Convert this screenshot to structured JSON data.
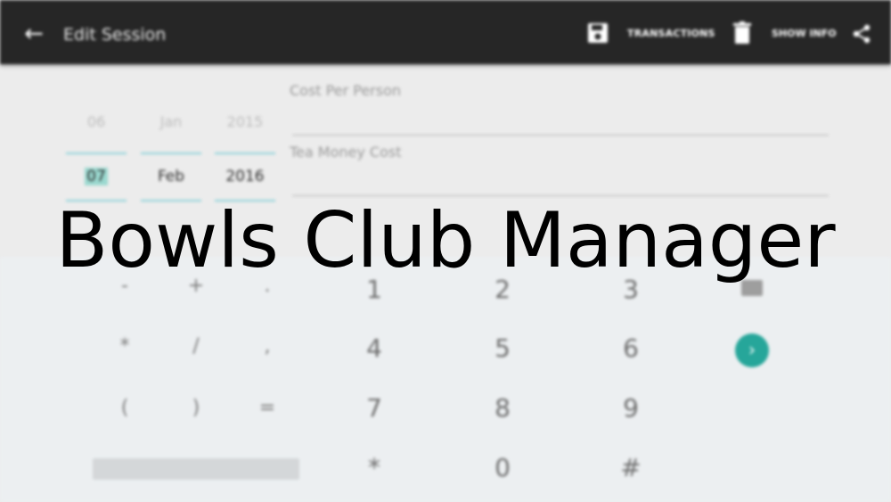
{
  "appbar": {
    "title": "Edit Session",
    "transactions_label": "TRANSACTIONS",
    "show_info_label": "SHOW INFO"
  },
  "date_picker": {
    "day": {
      "prev": "06",
      "selected": "07"
    },
    "month": {
      "prev": "Jan",
      "selected": "Feb"
    },
    "year": {
      "prev": "2015",
      "selected": "2016"
    }
  },
  "fields": {
    "cost_per_person_label": "Cost Per Person",
    "tea_money_cost_label": "Tea Money Cost"
  },
  "keyboard": {
    "symbols_row1": [
      "-",
      "+",
      "."
    ],
    "symbols_row2": [
      "*",
      "/",
      ","
    ],
    "symbols_row3": [
      "(",
      ")",
      "="
    ],
    "numbers": [
      [
        "1",
        "2",
        "3"
      ],
      [
        "4",
        "5",
        "6"
      ],
      [
        "7",
        "8",
        "9"
      ],
      [
        "*",
        "0",
        "#"
      ]
    ]
  },
  "overlay": {
    "title": "Bowls Club Manager"
  },
  "colors": {
    "accent": "#26a69a",
    "appbar": "#262626",
    "picker_line": "#8fd3da"
  }
}
